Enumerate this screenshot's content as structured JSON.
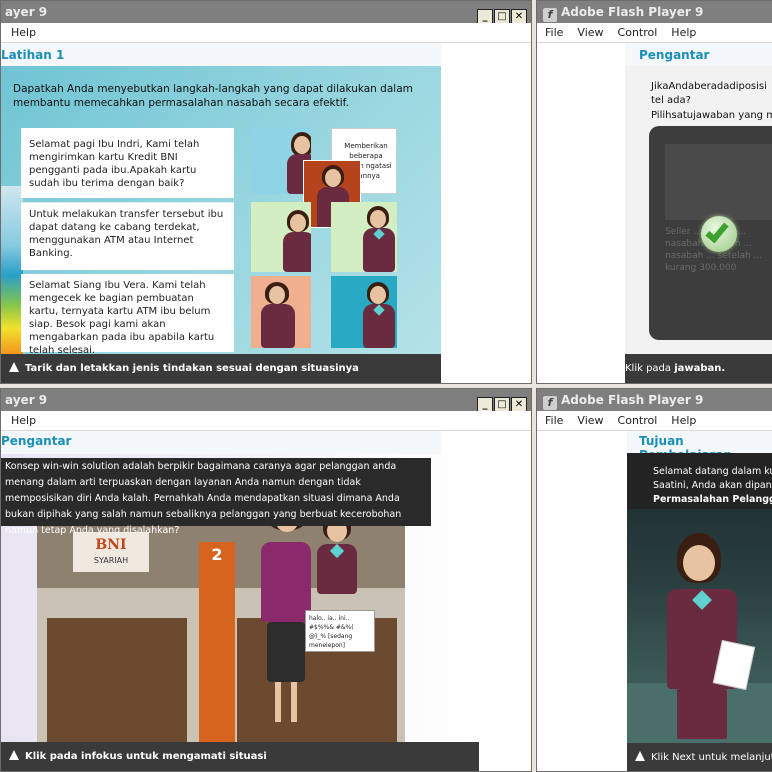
{
  "windows": {
    "top_left": {
      "title": "ayer 9",
      "menu": [
        "Help"
      ],
      "header": "Latihan 1",
      "instruction": "Dapatkah Anda menyebutkan langkah-langkah yang dapat dilakukan dalam membantu memecahkan permasalahan nasabah secara efektif.",
      "cards": [
        "Selamat pagi Ibu Indri, Kami telah mengirimkan kartu Kredit BNI pengganti pada ibu.Apakah kartu sudah ibu terima dengan baik?",
        "Untuk melakukan transfer tersebut ibu dapat datang ke cabang terdekat, menggunakan ATM atau Internet Banking.",
        "Selamat Siang Ibu Vera. Kami telah mengecek ke bagian pembuatan kartu, ternyata kartu ATM ibu belum siap. Besok pagi kami akan mengabarkan pada ibu apabila kartu telah selesai."
      ],
      "bubble": "Memberikan beberapa pilihan ngatasi ihannya",
      "bar": "Tarik dan letakkan jenis tindakan sesuai dengan situasinya"
    },
    "top_right": {
      "title": "Adobe Flash Player 9",
      "menu": [
        "File",
        "View",
        "Control",
        "Help"
      ],
      "header": "Pengantar",
      "question": "JikaAndaberadadiposisi tel ada?",
      "prompt": "Pilihsatujawaban yang me",
      "faded_text": "Seller ... bahwa ... nasabah ... telah ... nasabah ... setelah ... kurang 300.000",
      "feedback": "feedback",
      "bar_prefix": "Klik pada ",
      "bar_bold": "jawaban."
    },
    "bottom_left": {
      "title": "ayer 9",
      "menu": [
        "Help"
      ],
      "header": "Pengantar",
      "text": "Konsep win-win solution adalah berpikir bagaimana caranya agar pelanggan anda menang dalam arti terpuaskan dengan layanan Anda namun dengan tidak memposisikan diri Anda kalah. Pernahkah Anda mendapatkan situasi dimana Anda bukan dipihak yang salah namun sebaliknya pelanggan yang berbuat kecerobohan namun tetap Anda yang disalahkan?",
      "bank": "BNI",
      "bank_sub": "SYARIAH",
      "counter": "2",
      "speech": "halo.. ia.. ini.. #$%%& #&%( @)_% [sedang menelepon]",
      "bar": "Klik pada infokus untuk mengamati situasi"
    },
    "bottom_right": {
      "title": "Adobe Flash Player 9",
      "menu": [
        "File",
        "View",
        "Control",
        "Help"
      ],
      "header": "Tujuan Pembelajaran",
      "line1": "Selamat datang dalam kur",
      "line2": "Saatini, Anda akan dipand",
      "line3": "Permasalahan Pelanggan",
      "bar": "Klik Next untuk melanjutk"
    }
  },
  "colors": {
    "title_bar": "#7f7f7f",
    "header_blue": "#1a8fb8",
    "instruction_bar": "#3a3a3a",
    "uniform": "#6a2a3f",
    "scarf": "#5fd0d0"
  }
}
